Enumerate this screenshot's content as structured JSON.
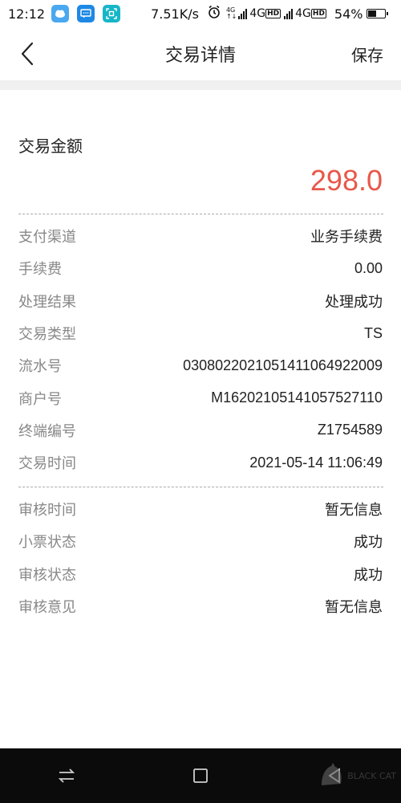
{
  "status_bar": {
    "time": "12:12",
    "speed": "7.51K/s",
    "network_1": "4G",
    "network_2": "4G",
    "hd_1": "HD",
    "hd_2": "HD",
    "battery_text": "54%",
    "battery_level": 0.54
  },
  "nav": {
    "title": "交易详情",
    "save_label": "保存"
  },
  "amount": {
    "label": "交易金额",
    "value": "298.0"
  },
  "details": [
    {
      "key": "支付渠道",
      "value": "业务手续费"
    },
    {
      "key": "手续费",
      "value": "0.00"
    },
    {
      "key": "处理结果",
      "value": "处理成功"
    },
    {
      "key": "交易类型",
      "value": "TS"
    },
    {
      "key": "流水号",
      "value": "030802202105141106492200​9"
    },
    {
      "key": "商户号",
      "value": "M16202105141057527110"
    },
    {
      "key": "终端编号",
      "value": "Z1754589"
    },
    {
      "key": "交易时间",
      "value": "2021-05-14 11:06:49"
    }
  ],
  "audit": [
    {
      "key": "审核时间",
      "value": "暂无信息"
    },
    {
      "key": "小票状态",
      "value": "成功"
    },
    {
      "key": "审核状态",
      "value": "成功"
    },
    {
      "key": "审核意见",
      "value": "暂无信息"
    }
  ],
  "icons": {
    "back": "chevron-left-icon",
    "sys_switch": "switch-arrows-icon",
    "sys_home": "square-home-icon",
    "sys_back": "triangle-back-icon"
  },
  "colors": {
    "amount": "#e8584a",
    "label_gray": "#888888",
    "divider": "#aaaaaa",
    "band": "#f0f0f0",
    "nav_bar_bottom": "#0b0b0b"
  },
  "watermark": {
    "text": "BLACK CAT"
  }
}
